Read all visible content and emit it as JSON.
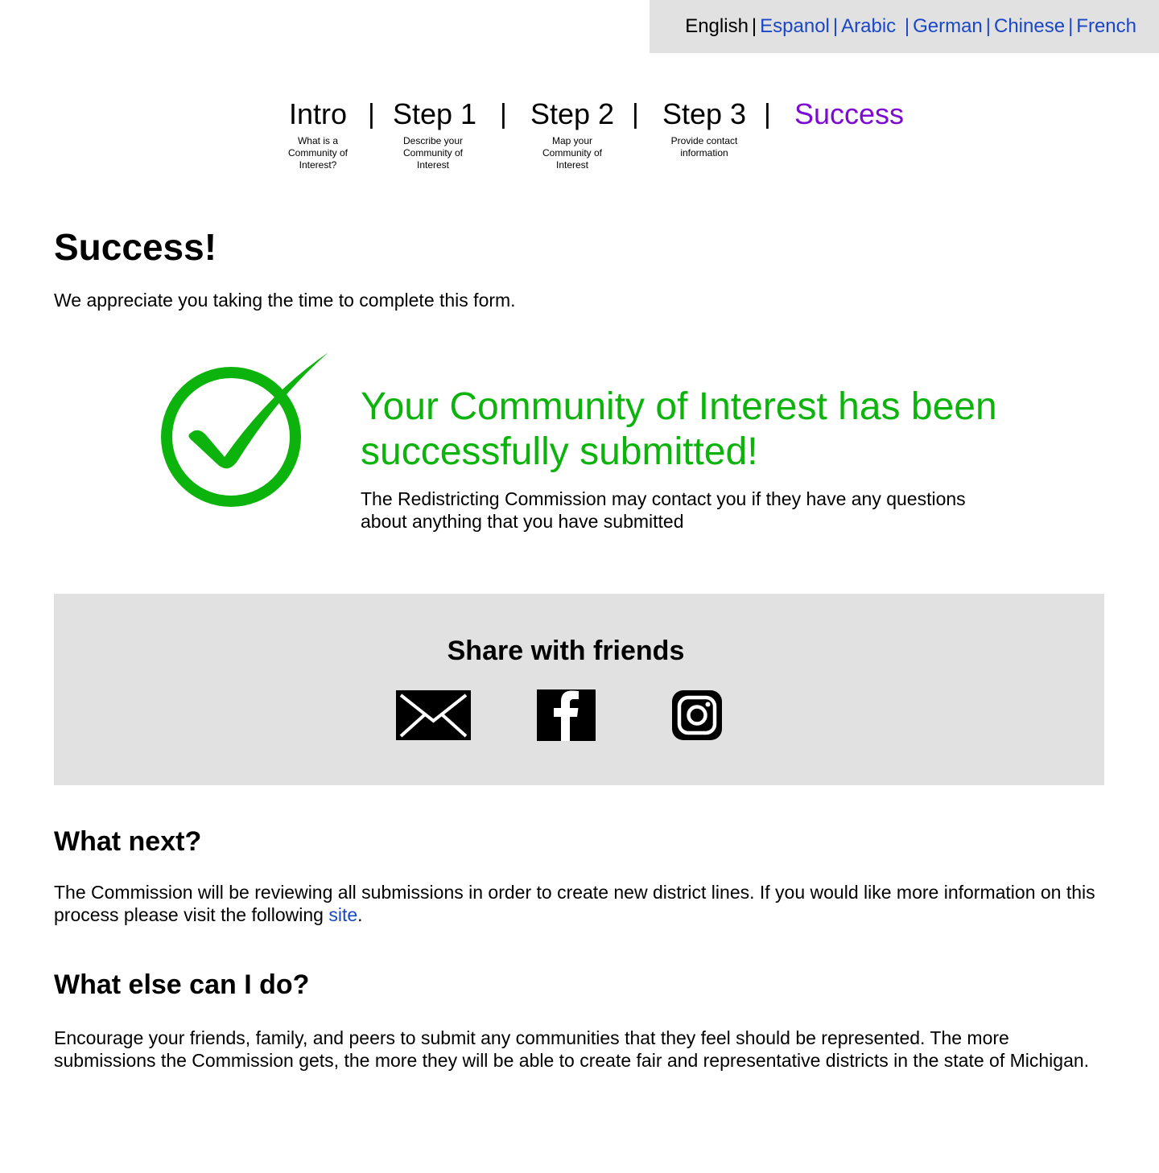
{
  "languages": {
    "current": "English",
    "links": [
      "Espanol",
      "Arabic",
      "German",
      "Chinese",
      "French"
    ],
    "separator": "|"
  },
  "steps": [
    {
      "title": "Intro",
      "subtitle": "What is a Community of Interest?"
    },
    {
      "title": "Step 1",
      "subtitle": "Describe your Community of Interest"
    },
    {
      "title": "Step 2",
      "subtitle": "Map your Community of Interest"
    },
    {
      "title": "Step 3",
      "subtitle": "Provide contact information"
    },
    {
      "title": "Success",
      "subtitle": ""
    }
  ],
  "step_divider": "|",
  "main": {
    "title": "Success!",
    "intro": "We appreciate you taking the time to complete this form.",
    "confirmation_heading": "Your Community of Interest has been successfully submitted!",
    "confirmation_text": "The Redistricting Commission may contact you if they have any questions about anything that you have submitted"
  },
  "share": {
    "heading": "Share with friends",
    "icons": [
      "mail-icon",
      "facebook-icon",
      "instagram-icon"
    ]
  },
  "what_next": {
    "heading": "What next?",
    "text_before": "The Commission will be reviewing all submissions in order to create new district lines. If you would like more information on this process please visit the following ",
    "link": "site",
    "text_after": "."
  },
  "what_else": {
    "heading": "What else can I do?",
    "text": "Encourage your friends, family, and peers to submit any communities that they feel should be represented. The more submissions the Commission gets, the more they will be able to create fair and representative districts in the state of Michigan."
  },
  "colors": {
    "success_green": "#0db30d",
    "link_blue": "#1a47c6",
    "active_step_purple": "#7d0bd1",
    "panel_gray": "#e1e1e1"
  }
}
